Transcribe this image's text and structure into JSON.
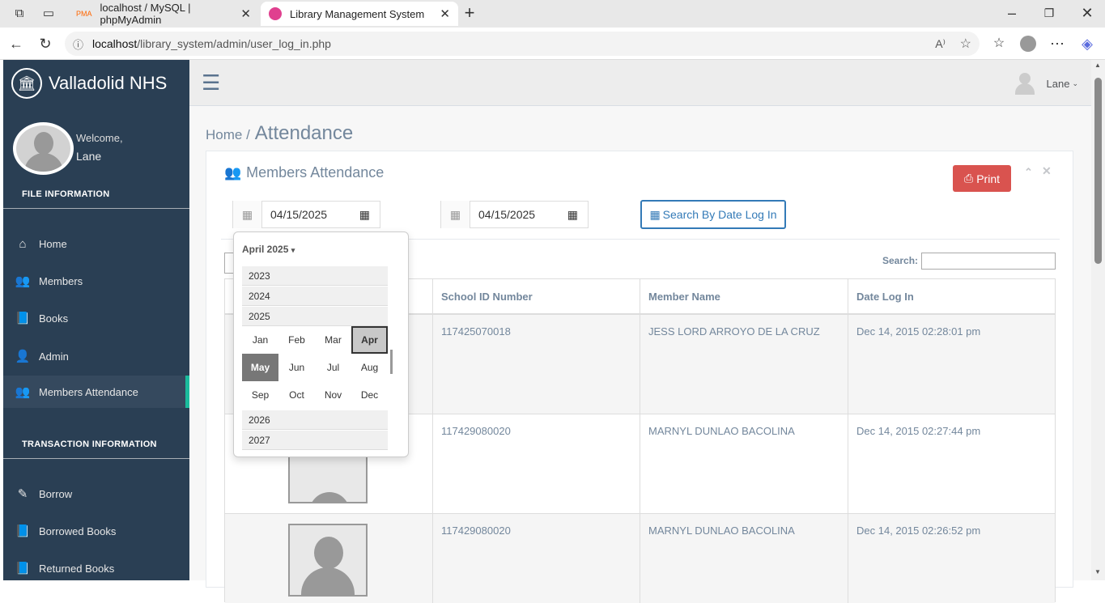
{
  "browser": {
    "tabs": [
      {
        "label": "localhost / MySQL | phpMyAdmin",
        "icon": "phpmyadmin-icon"
      },
      {
        "label": "Library Management System",
        "icon": "site-icon"
      }
    ],
    "url_host": "localhost",
    "url_path": "/library_system/admin/user_log_in.php"
  },
  "sidebar": {
    "brand": "Valladolid NHS",
    "welcome": "Welcome,",
    "username": "Lane",
    "section_file": "FILE INFORMATION",
    "section_transaction": "TRANSACTION INFORMATION",
    "file_items": [
      {
        "label": "Home",
        "icon": "home-icon"
      },
      {
        "label": "Members",
        "icon": "users-icon"
      },
      {
        "label": "Books",
        "icon": "book-icon"
      },
      {
        "label": "Admin",
        "icon": "user-icon"
      },
      {
        "label": "Members Attendance",
        "icon": "users-icon"
      }
    ],
    "transaction_items": [
      {
        "label": "Borrow",
        "icon": "edit-icon"
      },
      {
        "label": "Borrowed Books",
        "icon": "book-icon"
      },
      {
        "label": "Returned Books",
        "icon": "book-icon"
      }
    ]
  },
  "topbar": {
    "user": "Lane"
  },
  "breadcrumb": {
    "home": "Home /",
    "title": "Attendance"
  },
  "panel": {
    "title": "Members Attendance",
    "print_label": "Print",
    "date_from": "04/15/2025",
    "date_to": "04/15/2025",
    "search_btn": "Search By Date Log In",
    "search_label": "Search:"
  },
  "table": {
    "headers": [
      "School ID Number",
      "Member Name",
      "Date Log In"
    ],
    "rows": [
      {
        "id": "117425070018",
        "name": "JESS LORD ARROYO DE LA CRUZ",
        "date": "Dec 14, 2015 02:28:01 pm"
      },
      {
        "id": "117429080020",
        "name": "MARNYL DUNLAO BACOLINA",
        "date": "Dec 14, 2015 02:27:44 pm"
      },
      {
        "id": "117429080020",
        "name": "MARNYL DUNLAO BACOLINA",
        "date": "Dec 14, 2015 02:26:52 pm"
      }
    ]
  },
  "picker": {
    "header": "April 2025",
    "years_before": [
      "2023",
      "2024",
      "2025"
    ],
    "months": [
      "Jan",
      "Feb",
      "Mar",
      "Apr",
      "May",
      "Jun",
      "Jul",
      "Aug",
      "Sep",
      "Oct",
      "Nov",
      "Dec"
    ],
    "years_after": [
      "2026",
      "2027"
    ],
    "selected_month": "Apr",
    "current_month": "May"
  },
  "colors": {
    "sidebar": "#2a3f54",
    "accent": "#1abb9c",
    "print": "#d9534f",
    "link": "#337ab7"
  }
}
